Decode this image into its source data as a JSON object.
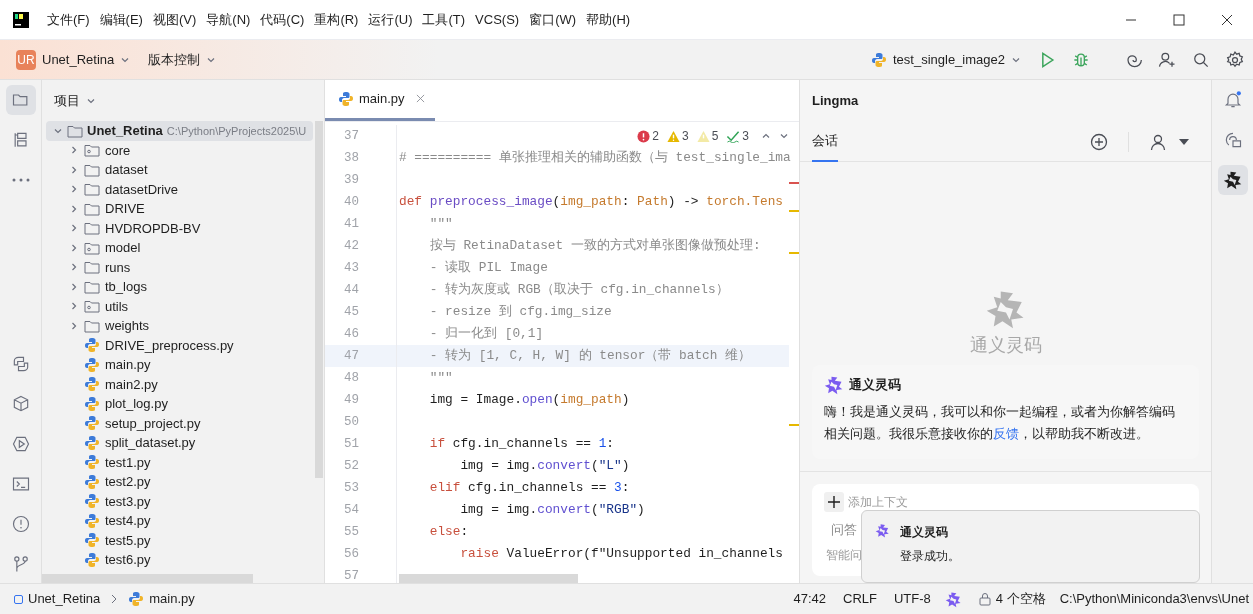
{
  "menu_bar": {
    "items": [
      "文件(F)",
      "编辑(E)",
      "视图(V)",
      "导航(N)",
      "代码(C)",
      "重构(R)",
      "运行(U)",
      "工具(T)",
      "VCS(S)",
      "窗口(W)",
      "帮助(H)"
    ]
  },
  "toolbar": {
    "project_badge": "UR",
    "project_name": "Unet_Retina",
    "vcs": "版本控制",
    "run_config": "test_single_image2"
  },
  "left_strip": [
    {
      "kind": "project",
      "selected": true
    },
    {
      "kind": "structure",
      "selected": false
    },
    {
      "kind": "more",
      "selected": false
    },
    {
      "kind": "python-console",
      "selected": false
    },
    {
      "kind": "packages",
      "selected": false
    },
    {
      "kind": "services",
      "selected": false
    },
    {
      "kind": "terminal",
      "selected": false
    },
    {
      "kind": "problems",
      "selected": false
    },
    {
      "kind": "git",
      "selected": false
    }
  ],
  "project_panel": {
    "title": "项目",
    "tree": [
      {
        "name": "Unet_Retina",
        "path": "C:\\Python\\PyProjects2025\\U",
        "kind": "folder",
        "expanded": true,
        "selected": true,
        "children": [
          {
            "name": "core",
            "kind": "module",
            "expanded": false,
            "selected": false
          },
          {
            "name": "dataset",
            "kind": "folder",
            "expanded": false,
            "selected": false
          },
          {
            "name": "datasetDrive",
            "kind": "folder",
            "expanded": false,
            "selected": false
          },
          {
            "name": "DRIVE",
            "kind": "folder",
            "expanded": false,
            "selected": false
          },
          {
            "name": "HVDROPDB-BV",
            "kind": "folder",
            "expanded": false,
            "selected": false
          },
          {
            "name": "model",
            "kind": "module",
            "expanded": false,
            "selected": false
          },
          {
            "name": "runs",
            "kind": "folder",
            "expanded": false,
            "selected": false
          },
          {
            "name": "tb_logs",
            "kind": "folder",
            "expanded": false,
            "selected": false
          },
          {
            "name": "utils",
            "kind": "module",
            "expanded": false,
            "selected": false
          },
          {
            "name": "weights",
            "kind": "folder",
            "expanded": false,
            "selected": false
          },
          {
            "name": "DRIVE_preprocess.py",
            "kind": "python",
            "selected": false
          },
          {
            "name": "main.py",
            "kind": "python",
            "selected": false
          },
          {
            "name": "main2.py",
            "kind": "python",
            "selected": false
          },
          {
            "name": "plot_log.py",
            "kind": "python",
            "selected": false
          },
          {
            "name": "setup_project.py",
            "kind": "python",
            "selected": false
          },
          {
            "name": "split_dataset.py",
            "kind": "python",
            "selected": false
          },
          {
            "name": "test1.py",
            "kind": "python",
            "selected": false
          },
          {
            "name": "test2.py",
            "kind": "python",
            "selected": false
          },
          {
            "name": "test3.py",
            "kind": "python",
            "selected": false
          },
          {
            "name": "test4.py",
            "kind": "python",
            "selected": false
          },
          {
            "name": "test5.py",
            "kind": "python",
            "selected": false
          },
          {
            "name": "test6.py",
            "kind": "python",
            "selected": false
          }
        ]
      }
    ]
  },
  "editor": {
    "tabs": [
      {
        "label": "main.py",
        "selected": true
      }
    ],
    "inspections": [
      {
        "kind": "error",
        "count": "2"
      },
      {
        "kind": "warning",
        "count": "3"
      },
      {
        "kind": "weak-warning",
        "count": "5"
      },
      {
        "kind": "typo",
        "count": "3"
      }
    ],
    "lines": [
      {
        "number": "37",
        "current": false
      },
      {
        "number": "38",
        "current": false,
        "tokens": [
          {
            "kind": "comment",
            "text": "# ========== 单张推理相关的辅助函数（与 test_single_ima"
          }
        ]
      },
      {
        "number": "39",
        "current": false
      },
      {
        "number": "40",
        "current": false,
        "tokens": [
          {
            "kind": "keyword",
            "text": "def"
          },
          {
            "kind": "function",
            "text": " preprocess_image"
          },
          {
            "kind": "plain",
            "text": "("
          },
          {
            "kind": "param",
            "text": "img_path"
          },
          {
            "kind": "plain",
            "text": ": "
          },
          {
            "kind": "param",
            "text": "Path"
          },
          {
            "kind": "plain",
            "text": ") -> "
          },
          {
            "kind": "param",
            "text": "torch.Tens"
          }
        ]
      },
      {
        "number": "41",
        "current": false,
        "tokens": [
          {
            "kind": "doc",
            "text": "    \"\"\""
          }
        ]
      },
      {
        "number": "42",
        "current": false,
        "tokens": [
          {
            "kind": "doc",
            "text": "    按与 RetinaDataset 一致的方式对单张图像做预处理:"
          }
        ]
      },
      {
        "number": "43",
        "current": false,
        "tokens": [
          {
            "kind": "doc",
            "text": "    - 读取 PIL Image"
          }
        ]
      },
      {
        "number": "44",
        "current": false,
        "tokens": [
          {
            "kind": "doc",
            "text": "    - 转为灰度或 RGB（取决于 cfg.in_channels）"
          }
        ]
      },
      {
        "number": "45",
        "current": false,
        "tokens": [
          {
            "kind": "doc",
            "text": "    - resize 到 cfg.img_size"
          }
        ]
      },
      {
        "number": "46",
        "current": false,
        "tokens": [
          {
            "kind": "doc",
            "text": "    - 归一化到 [0,1]"
          }
        ]
      },
      {
        "number": "47",
        "current": true,
        "tokens": [
          {
            "kind": "doc",
            "text": "    - 转为 [1, C, H, W] 的 tensor（带 batch 维）"
          }
        ]
      },
      {
        "number": "48",
        "current": false,
        "tokens": [
          {
            "kind": "doc",
            "text": "    \"\"\""
          }
        ]
      },
      {
        "number": "49",
        "current": false,
        "tokens": [
          {
            "kind": "plain",
            "text": "    img = Image."
          },
          {
            "kind": "call",
            "text": "open"
          },
          {
            "kind": "plain",
            "text": "("
          },
          {
            "kind": "param",
            "text": "img_path"
          },
          {
            "kind": "plain",
            "text": ")"
          }
        ]
      },
      {
        "number": "50",
        "current": false
      },
      {
        "number": "51",
        "current": false,
        "tokens": [
          {
            "kind": "keyword",
            "text": "    if"
          },
          {
            "kind": "plain",
            "text": " cfg.in_channels == "
          },
          {
            "kind": "number",
            "text": "1"
          },
          {
            "kind": "plain",
            "text": ":"
          }
        ]
      },
      {
        "number": "52",
        "current": false,
        "tokens": [
          {
            "kind": "plain",
            "text": "        img = img."
          },
          {
            "kind": "call",
            "text": "convert"
          },
          {
            "kind": "plain",
            "text": "("
          },
          {
            "kind": "string",
            "text": "\"L\""
          },
          {
            "kind": "plain",
            "text": ")"
          }
        ]
      },
      {
        "number": "53",
        "current": false,
        "tokens": [
          {
            "kind": "keyword",
            "text": "    elif"
          },
          {
            "kind": "plain",
            "text": " cfg.in_channels == "
          },
          {
            "kind": "number",
            "text": "3"
          },
          {
            "kind": "plain",
            "text": ":"
          }
        ]
      },
      {
        "number": "54",
        "current": false,
        "tokens": [
          {
            "kind": "plain",
            "text": "        img = img."
          },
          {
            "kind": "call",
            "text": "convert"
          },
          {
            "kind": "plain",
            "text": "("
          },
          {
            "kind": "string",
            "text": "\"RGB\""
          },
          {
            "kind": "plain",
            "text": ")"
          }
        ]
      },
      {
        "number": "55",
        "current": false,
        "tokens": [
          {
            "kind": "keyword",
            "text": "    else"
          },
          {
            "kind": "plain",
            "text": ":"
          }
        ]
      },
      {
        "number": "56",
        "current": false,
        "tokens": [
          {
            "kind": "keyword",
            "text": "        raise"
          },
          {
            "kind": "plain",
            "text": " ValueError(f\"Unsupported in_channels"
          }
        ]
      },
      {
        "number": "57",
        "current": false
      }
    ]
  },
  "lingma": {
    "title": "Lingma",
    "tabs": [
      {
        "label": "会话",
        "selected": true
      }
    ],
    "empty_title": "通义灵码",
    "welcome": {
      "title": "通义灵码",
      "text_before": "嗨！我是通义灵码，我可以和你一起编程，或者为你解答编码相关问题。我很乐意接收你的",
      "link": "反馈",
      "text_after": "，以帮助我不断改进。"
    },
    "input": {
      "context_button": "添加上下文",
      "mode": "问答",
      "hint": "智能问"
    },
    "notification": {
      "title": "通义灵码",
      "message": "登录成功。"
    }
  },
  "right_strip": [
    {
      "kind": "notifications",
      "selected": false
    },
    {
      "kind": "ai-chat",
      "selected": false
    },
    {
      "kind": "lingma",
      "selected": true
    }
  ],
  "status_bar": {
    "breadcrumbs": [
      "Unet_Retina",
      "main.py"
    ],
    "position": "47:42",
    "line_separator": "CRLF",
    "encoding": "UTF-8",
    "indent": "4 个空格",
    "interpreter": "C:\\Python\\Miniconda3\\envs\\Unet"
  }
}
